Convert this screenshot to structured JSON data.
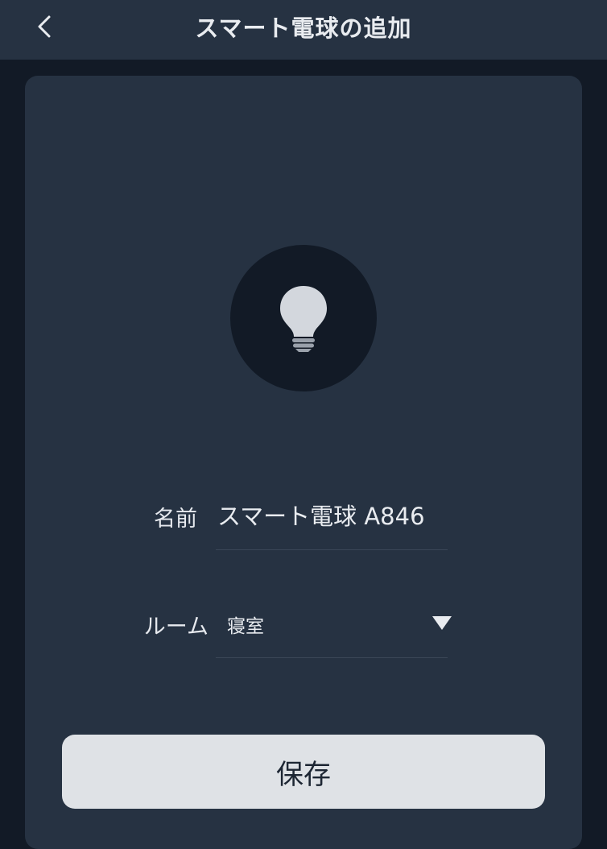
{
  "header": {
    "title": "スマート電球の追加",
    "back_icon": "chevron-left-icon"
  },
  "device": {
    "icon": "lightbulb-icon"
  },
  "form": {
    "name": {
      "label": "名前",
      "value": "スマート電球 A846"
    },
    "room": {
      "label": "ルーム",
      "selected": "寝室",
      "icon": "triangle-down-icon"
    }
  },
  "actions": {
    "save_label": "保存"
  },
  "colors": {
    "background": "#121a26",
    "surface": "#263242",
    "text": "#e9ecf0",
    "button": "#dfe2e6"
  }
}
